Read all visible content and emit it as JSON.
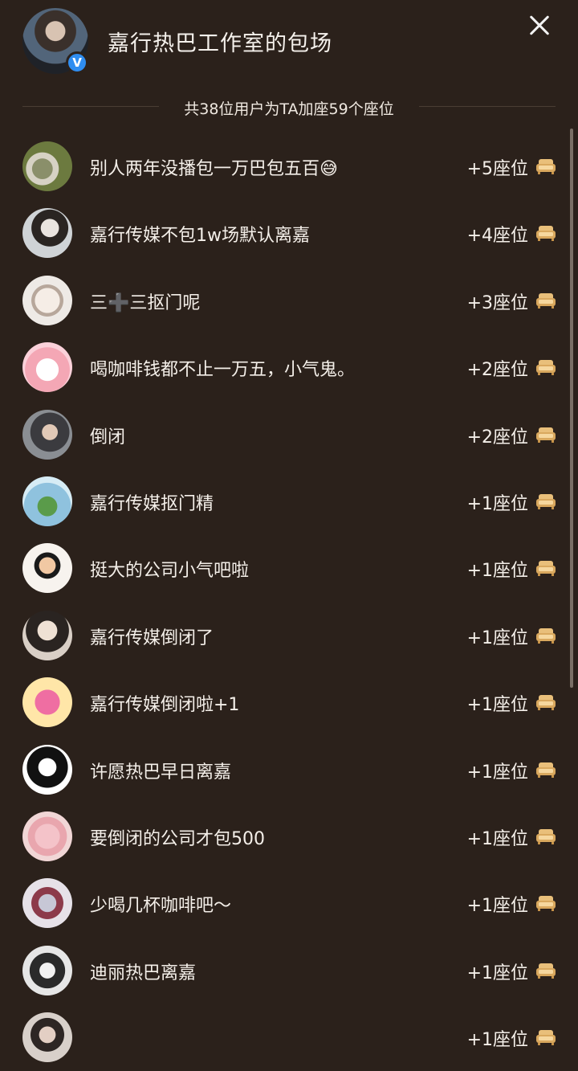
{
  "header": {
    "title": "嘉行热巴工作室的包场",
    "verified_mark": "V"
  },
  "summary": "共38位用户为TA加座59个座位",
  "rows": [
    {
      "message": "别人两年没播包一万巴包五百😅",
      "seats": "+5座位"
    },
    {
      "message": "嘉行传媒不包1w场默认离嘉",
      "seats": "+4座位"
    },
    {
      "message": "三➕三抠门呢",
      "seats": "+3座位"
    },
    {
      "message": "喝咖啡钱都不止一万五，小气鬼。",
      "seats": "+2座位"
    },
    {
      "message": "倒闭",
      "seats": "+2座位"
    },
    {
      "message": "嘉行传媒抠门精",
      "seats": "+1座位"
    },
    {
      "message": "挺大的公司小气吧啦",
      "seats": "+1座位"
    },
    {
      "message": "嘉行传媒倒闭了",
      "seats": "+1座位"
    },
    {
      "message": "嘉行传媒倒闭啦+1",
      "seats": "+1座位"
    },
    {
      "message": "许愿热巴早日离嘉",
      "seats": "+1座位"
    },
    {
      "message": "要倒闭的公司才包500",
      "seats": "+1座位"
    },
    {
      "message": "少喝几杯咖啡吧～",
      "seats": "+1座位"
    },
    {
      "message": "迪丽热巴离嘉",
      "seats": "+1座位"
    },
    {
      "message": "",
      "seats": "+1座位"
    }
  ],
  "colors": {
    "background": "#2b211b",
    "text": "#f4efe9",
    "sofa_icon": "#e9bf7a",
    "verified": "#2f8df0"
  },
  "icons": {
    "close": "close-icon",
    "seat": "sofa-icon",
    "verified": "verified-badge-icon"
  }
}
